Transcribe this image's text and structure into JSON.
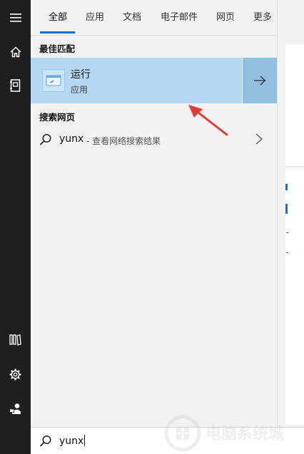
{
  "rail": {
    "items": [
      {
        "name": "hamburger-menu-icon"
      },
      {
        "name": "home-icon"
      },
      {
        "name": "notebook-icon"
      },
      {
        "name": "documents-icon"
      },
      {
        "name": "settings-gear-icon"
      },
      {
        "name": "user-feedback-icon"
      }
    ]
  },
  "tabs": {
    "items": [
      "全部",
      "应用",
      "文档",
      "电子邮件",
      "网页",
      "更多"
    ],
    "active_index": 0,
    "accent": "#0a6dd8"
  },
  "results": {
    "best_match_header": "最佳匹配",
    "best_match": {
      "title": "运行",
      "subtitle": "应用",
      "icon": "run-dialog-icon"
    },
    "web_header": "搜索网页",
    "web_item": {
      "term": "yunx",
      "description": "- 查看网络搜索结果"
    }
  },
  "search": {
    "value": "yunx"
  },
  "colors": {
    "highlight": "#b5d8f2",
    "highlight_action": "#92bfe0",
    "rail": "#1f1f1f",
    "annotation": "#e53935"
  }
}
